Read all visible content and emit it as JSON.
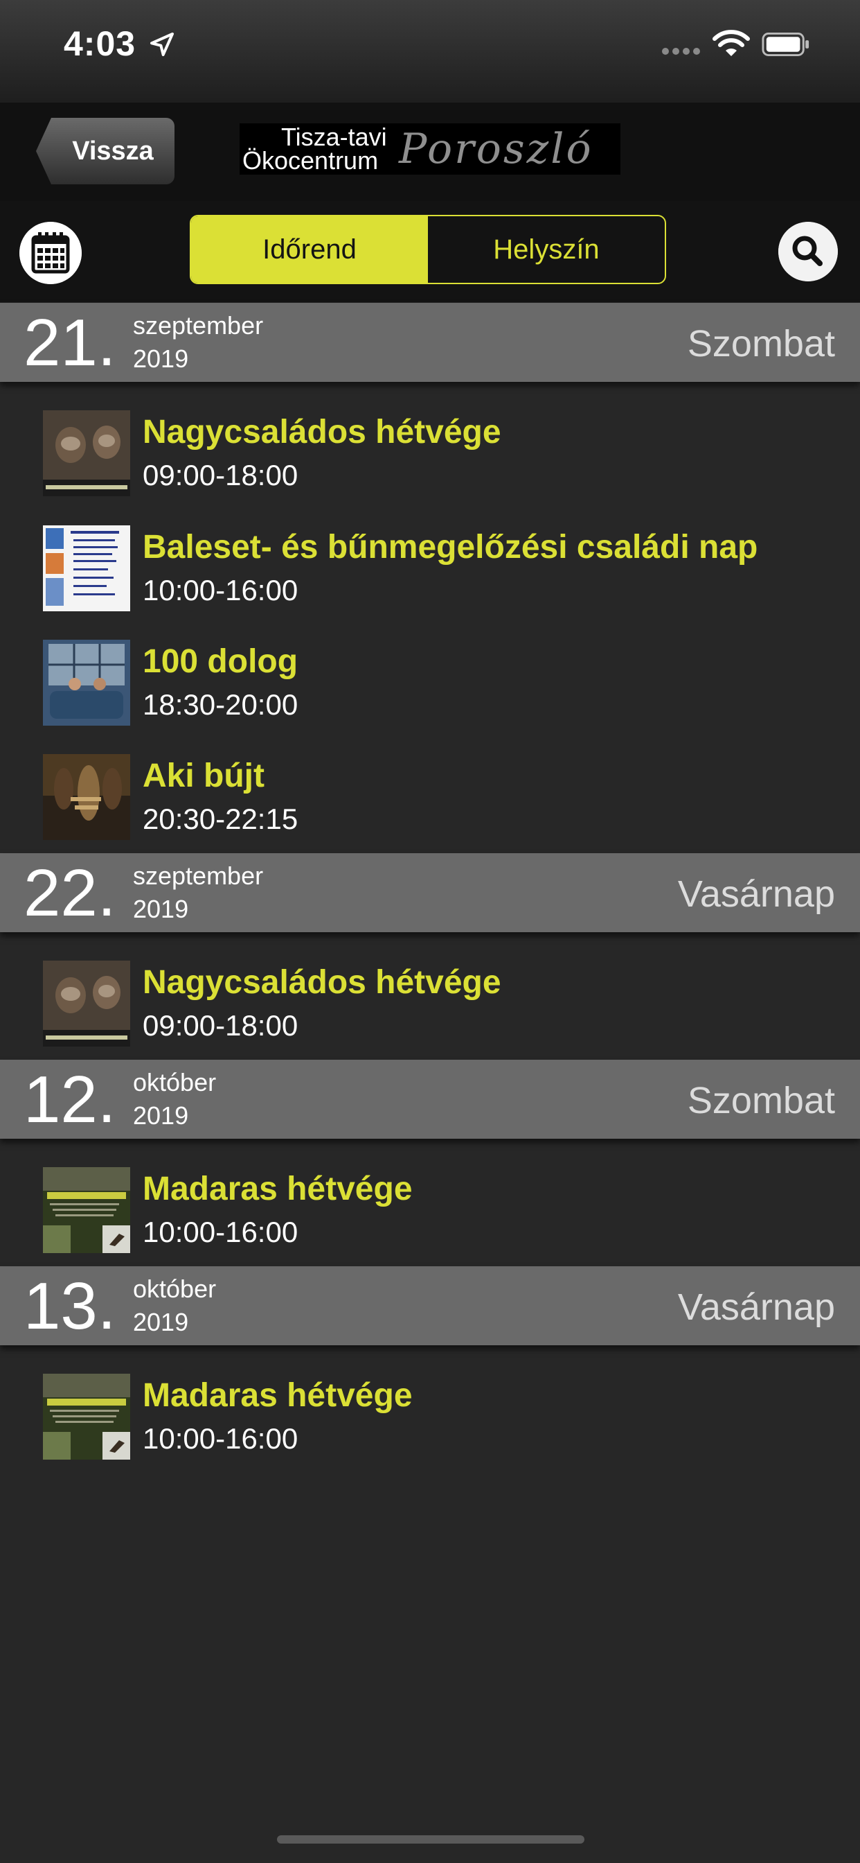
{
  "status_bar": {
    "time": "4:03"
  },
  "nav": {
    "back_label": "Vissza",
    "logo_line1": "Tisza-tavi",
    "logo_line2": "Ökocentrum",
    "logo_script": "Poroszló"
  },
  "toolbar": {
    "tab_schedule": "Időrend",
    "tab_location": "Helyszín"
  },
  "days": [
    {
      "day": "21",
      "month": "szeptember",
      "year": "2019",
      "weekday": "Szombat",
      "events": [
        {
          "title": "Nagycsaládos hétvége",
          "time": "09:00-18:00",
          "thumb": "otters-image"
        },
        {
          "title": "Baleset- és bűnmegelőzési családi nap",
          "time": "10:00-16:00",
          "thumb": "poster-image"
        },
        {
          "title": "100 dolog",
          "time": "18:30-20:00",
          "thumb": "movie-still-image"
        },
        {
          "title": "Aki bújt",
          "time": "20:30-22:15",
          "thumb": "movie-poster-image"
        }
      ]
    },
    {
      "day": "22",
      "month": "szeptember",
      "year": "2019",
      "weekday": "Vasárnap",
      "events": [
        {
          "title": "Nagycsaládos hétvége",
          "time": "09:00-18:00",
          "thumb": "otters-image"
        }
      ]
    },
    {
      "day": "12",
      "month": "október",
      "year": "2019",
      "weekday": "Szombat",
      "events": [
        {
          "title": "Madaras hétvége",
          "time": "10:00-16:00",
          "thumb": "birds-poster-image"
        }
      ]
    },
    {
      "day": "13",
      "month": "október",
      "year": "2019",
      "weekday": "Vasárnap",
      "events": [
        {
          "title": "Madaras hétvége",
          "time": "10:00-16:00",
          "thumb": "birds-poster-image"
        }
      ]
    }
  ],
  "colors": {
    "accent": "#dbe035",
    "background": "#272727",
    "header": "#6a6a6a"
  },
  "icons": [
    "location-arrow-icon",
    "signal-icon",
    "wifi-icon",
    "battery-icon",
    "calendar-icon",
    "search-icon"
  ]
}
